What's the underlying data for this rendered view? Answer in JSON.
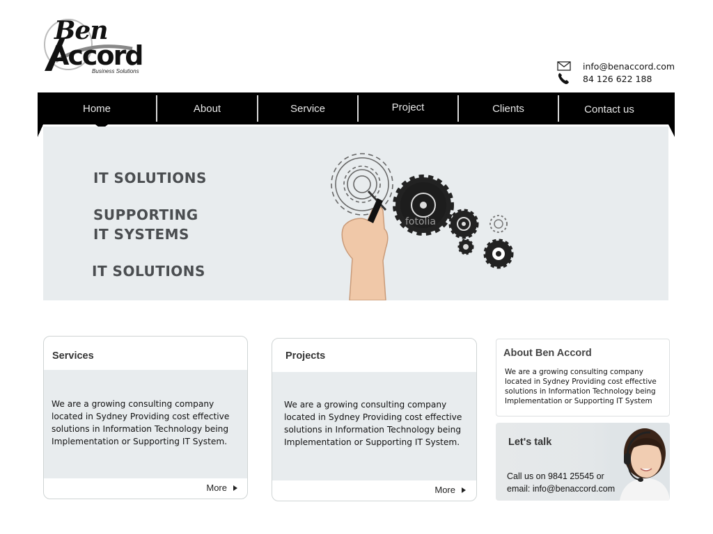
{
  "brand": {
    "logo_top": "Ben",
    "logo_bottom": "Accord",
    "logo_tagline": "Business Solutions"
  },
  "contact": {
    "email_icon": "envelope-icon",
    "email": "info@benaccord.com",
    "phone_icon": "phone-icon",
    "phone": "84 126 622 188"
  },
  "nav": {
    "items": [
      {
        "label": "Home",
        "active": true
      },
      {
        "label": "About"
      },
      {
        "label": "Service"
      },
      {
        "label": "Project"
      },
      {
        "label": "Clients"
      },
      {
        "label": "Contact us"
      }
    ]
  },
  "banner": {
    "line1": "IT SOLUTIONS",
    "line2": "SUPPORTING",
    "line3": "IT SYSTEMS",
    "line4": "IT SOLUTIONS",
    "art": "hand-drawing-gears-illustration",
    "watermark": "fotolia"
  },
  "services": {
    "title": "Services",
    "text": "We are a growing consulting company located in Sydney Providing cost effective solutions in Information Technology being Implementation or Supporting IT System.",
    "more": "More"
  },
  "projects": {
    "title": "Projects",
    "text": "We are a growing consulting company located in Sydney Providing cost effective solutions in Information Technology being Implementation or Supporting IT System.",
    "more": "More"
  },
  "about": {
    "title": "About Ben Accord",
    "text": "We are a growing consulting company located in Sydney Providing cost effective solutions in Information Technology being Implementation or Supporting IT System"
  },
  "talk": {
    "title": "Let's talk",
    "line1": "Call us on 9841 25545 or",
    "line2": "email: info@benaccord.com",
    "photo": "support-agent-with-headset"
  },
  "colors": {
    "nav_bg": "#000000",
    "panel_bg": "#e8ecee",
    "banner_text": "#4a4d50"
  }
}
